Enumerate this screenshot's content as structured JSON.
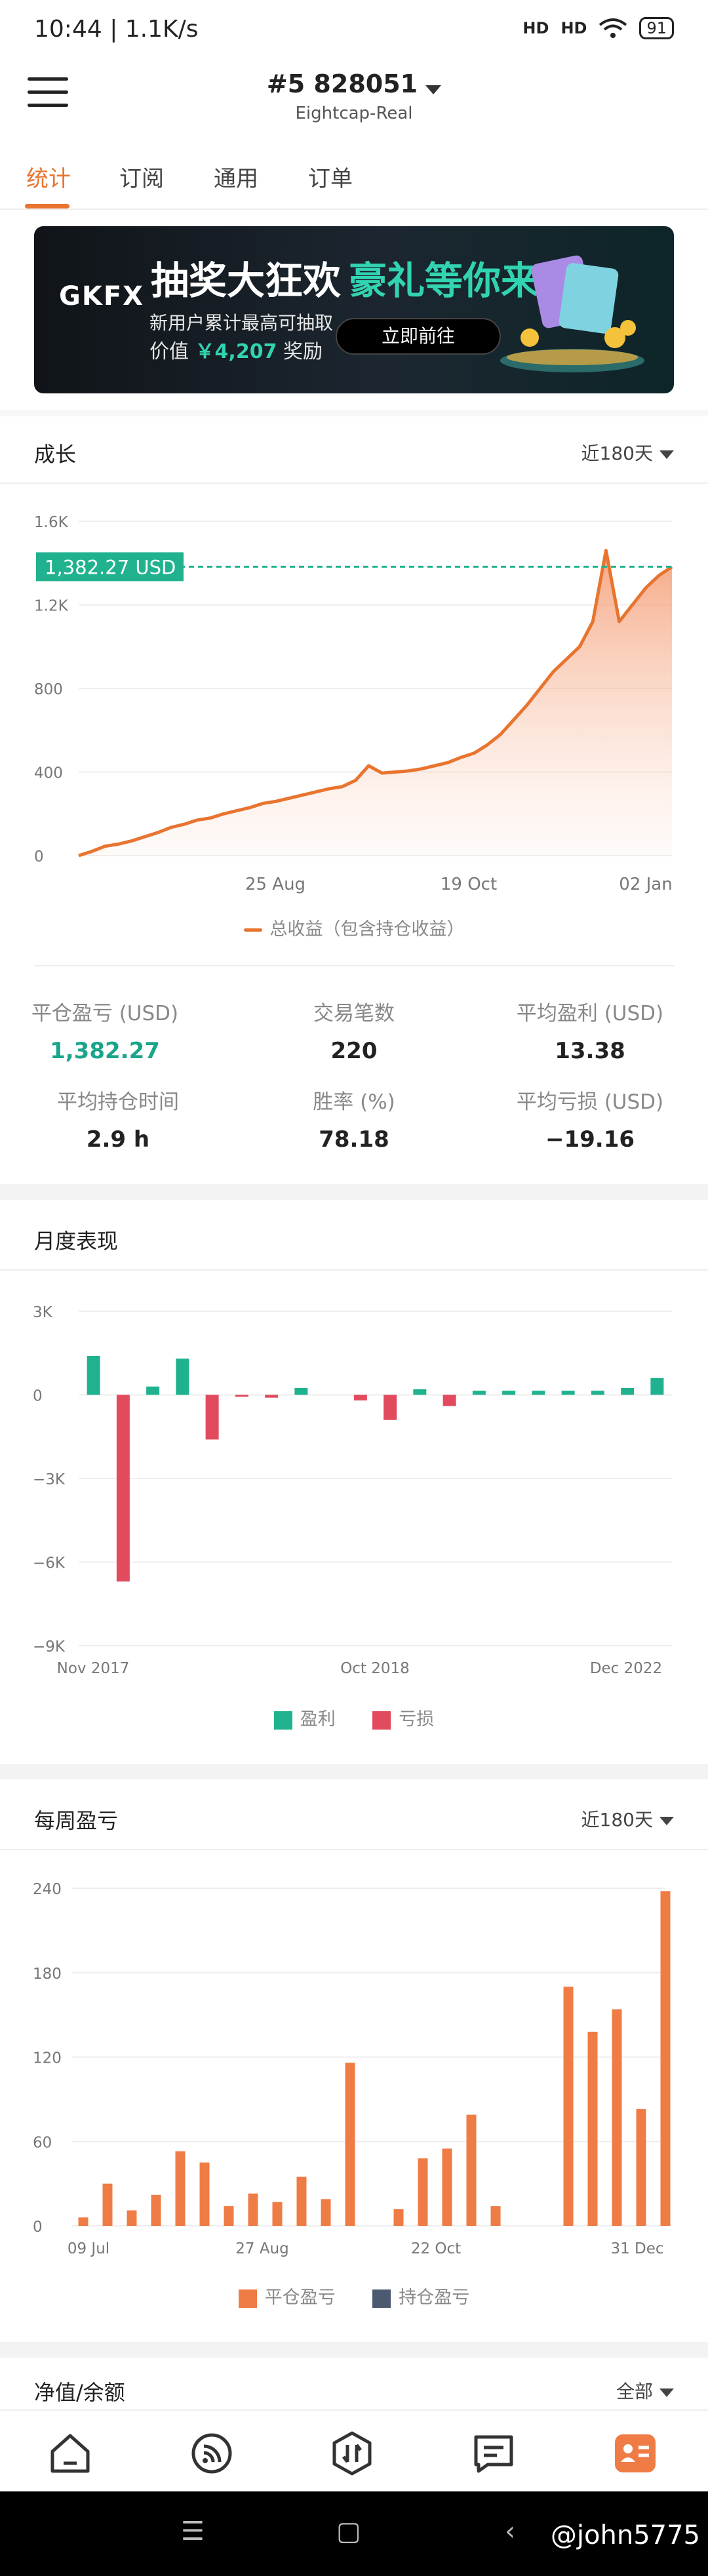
{
  "status_bar": {
    "time": "10:44 | 1.1K/s",
    "battery": "91",
    "signal_1": "HD",
    "signal_2": "HD"
  },
  "header": {
    "account_number": "#5  828051",
    "account_server": "Eightcap-Real"
  },
  "tabs": [
    {
      "label": "统计",
      "active": true
    },
    {
      "label": "订阅",
      "active": false
    },
    {
      "label": "通用",
      "active": false
    },
    {
      "label": "订单",
      "active": false
    }
  ],
  "banner": {
    "logo": "GKFX",
    "headline_1": "抽奖大狂欢",
    "headline_2": "豪礼等你来",
    "line_2": "新用户累计最高可抽取",
    "line_3_prefix": "价值",
    "amount": "￥4,207",
    "line_3_suffix": "奖励",
    "cta": "立即前往"
  },
  "growth": {
    "title": "成长",
    "range": "近180天",
    "current_value_label": "1,382.27 USD",
    "legend": "总收益（包含持仓收益）",
    "line_color": "#e8742f",
    "chart_data": {
      "type": "area",
      "title": "",
      "y_ticks": [
        "0",
        "400",
        "800",
        "1.2K",
        "1.6K"
      ],
      "ylim": [
        0,
        1600
      ],
      "x_ticks": [
        "25 Aug",
        "19 Oct",
        "02 Jan"
      ],
      "current_value": 1382.27,
      "series": [
        {
          "name": "总收益（包含持仓收益）",
          "values": [
            0,
            20,
            45,
            55,
            70,
            90,
            110,
            135,
            150,
            170,
            180,
            200,
            215,
            230,
            250,
            260,
            275,
            290,
            305,
            320,
            330,
            360,
            430,
            395,
            400,
            405,
            415,
            430,
            445,
            470,
            490,
            530,
            580,
            650,
            720,
            800,
            880,
            940,
            1000,
            1120,
            1460,
            1120,
            1200,
            1280,
            1340,
            1382
          ]
        }
      ]
    }
  },
  "stats": {
    "items": [
      {
        "label": "平仓盈亏 (USD)",
        "value": "1,382.27",
        "green": true
      },
      {
        "label": "交易笔数",
        "value": "220",
        "green": false
      },
      {
        "label": "平均盈利 (USD)",
        "value": "13.38",
        "green": false
      },
      {
        "label": "平均持仓时间",
        "value": "2.9 h",
        "green": false
      },
      {
        "label": "胜率 (%)",
        "value": "78.18",
        "green": false
      },
      {
        "label": "平均亏损 (USD)",
        "value": "−19.16",
        "green": false
      }
    ]
  },
  "monthly": {
    "title": "月度表现",
    "legend_profit": "盈利",
    "legend_loss": "亏损",
    "profit_color": "#20b28e",
    "loss_color": "#e24b5e",
    "chart_data": {
      "type": "bar",
      "title": "",
      "y_ticks": [
        "3K",
        "0",
        "−3K",
        "−6K",
        "−9K"
      ],
      "ylim": [
        -9000,
        3000
      ],
      "x_ticks": [
        "Nov 2017",
        "Oct 2018",
        "Dec 2022"
      ],
      "values": [
        1400,
        -6700,
        300,
        1300,
        -1600,
        -50,
        -100,
        250,
        0,
        -200,
        -900,
        200,
        -400,
        150,
        150,
        150,
        150,
        150,
        250,
        600
      ]
    }
  },
  "weekly": {
    "title": "每周盈亏",
    "range": "近180天",
    "legend_closed": "平仓盈亏",
    "legend_open": "持仓盈亏",
    "closed_color": "#f07c45",
    "open_color": "#4b5a70",
    "chart_data": {
      "type": "bar",
      "title": "",
      "y_ticks": [
        "0",
        "60",
        "120",
        "180",
        "240"
      ],
      "ylim": [
        0,
        240
      ],
      "x_ticks": [
        "09 Jul",
        "27 Aug",
        "22 Oct",
        "31 Dec"
      ],
      "values": [
        6,
        30,
        11,
        22,
        53,
        45,
        14,
        23,
        17,
        35,
        19,
        116,
        0,
        12,
        48,
        55,
        79,
        14,
        0,
        0,
        170,
        138,
        154,
        83,
        238
      ]
    }
  },
  "balance": {
    "title": "净值/余额",
    "range": "全部"
  },
  "bottom_nav": [
    "home-icon",
    "feed-icon",
    "trade-icon",
    "messages-icon",
    "profile-icon"
  ],
  "watermark": "@john5775"
}
